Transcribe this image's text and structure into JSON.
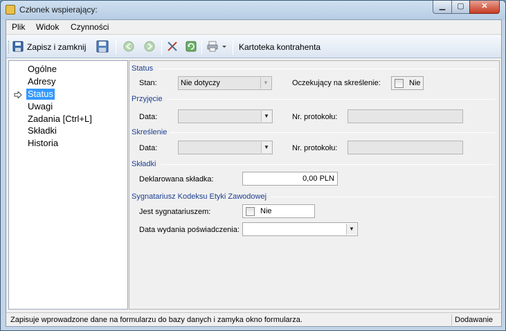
{
  "window": {
    "title": "Członek wspierający:",
    "minimize": "▁",
    "maximize": "▢",
    "close": "✕"
  },
  "menu": {
    "items": [
      "Plik",
      "Widok",
      "Czynności"
    ]
  },
  "toolbar": {
    "save_close_label": "Zapisz i zamknij",
    "card_label": "Kartoteka kontrahenta"
  },
  "nav": {
    "items": [
      "Ogólne",
      "Adresy",
      "Status",
      "Uwagi",
      "Zadania [Ctrl+L]",
      "Składki",
      "Historia"
    ],
    "selected": "Status"
  },
  "form": {
    "status": {
      "title": "Status",
      "stan_label": "Stan:",
      "stan_value": "Nie dotyczy",
      "pending_label": "Oczekujący na skreślenie:",
      "pending_value": "Nie"
    },
    "przyjecie": {
      "title": "Przyjęcie",
      "data_label": "Data:",
      "data_value": "",
      "protokol_label": "Nr. protokołu:",
      "protokol_value": ""
    },
    "skreslenie": {
      "title": "Skreślenie",
      "data_label": "Data:",
      "data_value": "",
      "protokol_label": "Nr. protokołu:",
      "protokol_value": ""
    },
    "skladki": {
      "title": "Składki",
      "declared_label": "Deklarowana składka:",
      "declared_value": "0,00 PLN"
    },
    "sygnatariusz": {
      "title": "Sygnatariusz Kodeksu Etyki Zawodowej",
      "jest_label": "Jest sygnatariuszem:",
      "jest_value": "Nie",
      "data_label": "Data wydania poświadczenia:",
      "data_value": ""
    }
  },
  "statusbar": {
    "hint": "Zapisuje wprowadzone dane na formularzu do bazy danych i zamyka okno formularza.",
    "mode": "Dodawanie"
  },
  "colors": {
    "selection": "#3399ff",
    "group_title": "#1d3f8f",
    "toolbar_top": "#f5f8fc",
    "toolbar_bottom": "#dbe5f1"
  }
}
